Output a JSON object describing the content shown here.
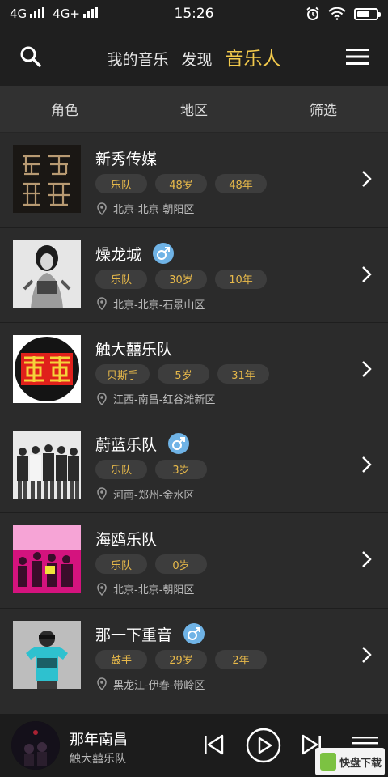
{
  "status": {
    "carrier1": "4G",
    "carrier2": "4G+",
    "time": "15:26"
  },
  "header": {
    "tabs": [
      "我的音乐",
      "发现",
      "音乐人"
    ],
    "active_tab": "音乐人",
    "icons": {
      "left": "search-icon",
      "right": "menu-icon"
    }
  },
  "filters": [
    "角色",
    "地区",
    "筛选"
  ],
  "artists": [
    {
      "name": "新秀传媒",
      "gender": "",
      "tags": [
        "乐队",
        "48岁",
        "48年"
      ],
      "location": "北京-北京-朝阳区"
    },
    {
      "name": "燥龙城",
      "gender": "male",
      "tags": [
        "乐队",
        "30岁",
        "10年"
      ],
      "location": "北京-北京-石景山区"
    },
    {
      "name": "触大囍乐队",
      "gender": "",
      "tags": [
        "贝斯手",
        "5岁",
        "31年"
      ],
      "location": "江西-南昌-红谷滩新区"
    },
    {
      "name": "蔚蓝乐队",
      "gender": "male",
      "tags": [
        "乐队",
        "3岁"
      ],
      "location": "河南-郑州-金水区"
    },
    {
      "name": "海鸥乐队",
      "gender": "",
      "tags": [
        "乐队",
        "0岁"
      ],
      "location": "北京-北京-朝阳区"
    },
    {
      "name": "那一下重音",
      "gender": "male",
      "tags": [
        "鼓手",
        "29岁",
        "2年"
      ],
      "location": "黑龙江-伊春-带岭区"
    }
  ],
  "player": {
    "title": "那年南昌",
    "artist": "触大囍乐队"
  },
  "colors": {
    "accent": "#f2c94c",
    "tag_text": "#e7b94a",
    "male_badge": "#6fb3e6"
  }
}
